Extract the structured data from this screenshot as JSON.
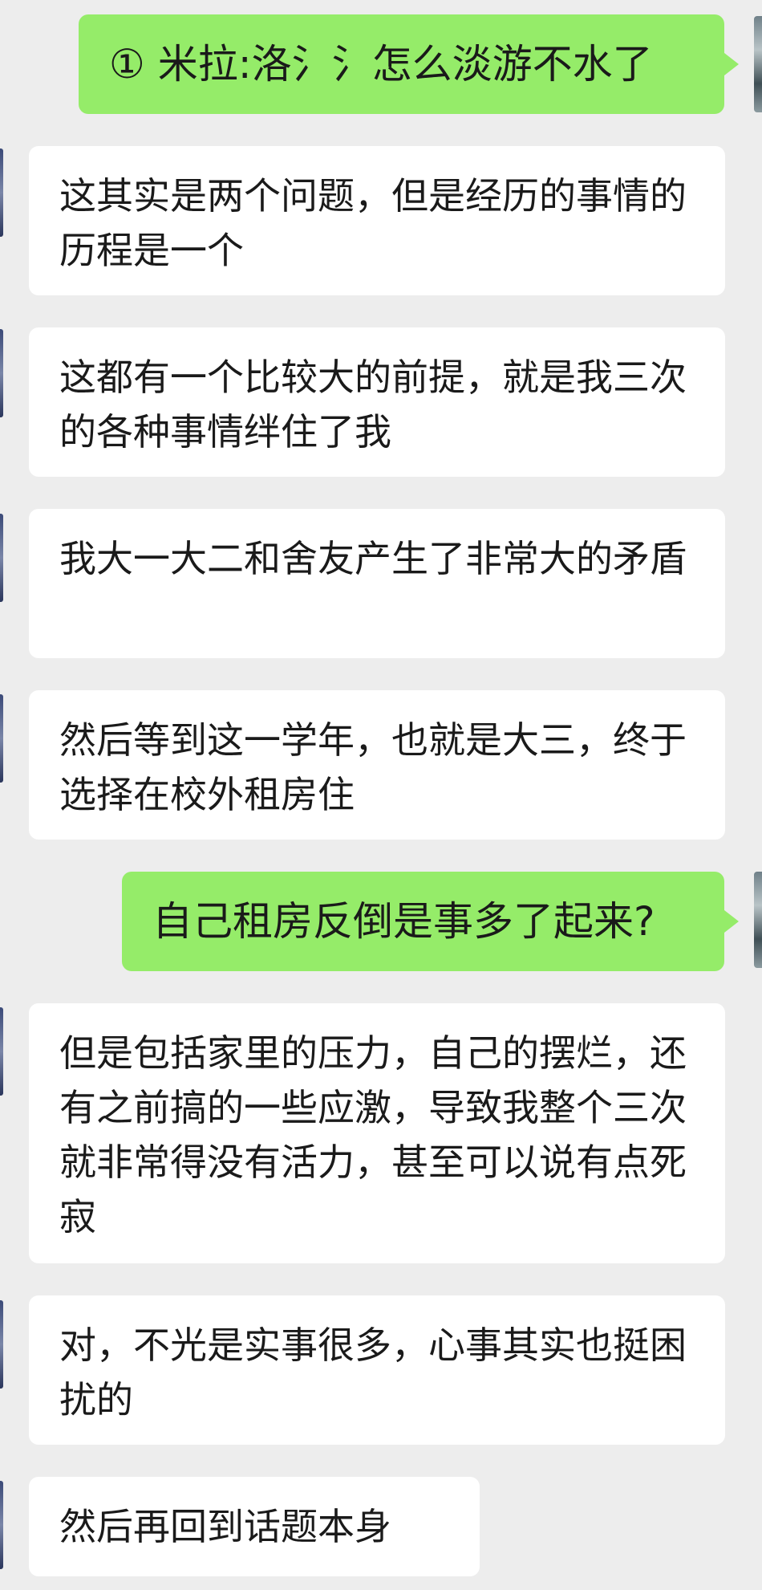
{
  "chat": {
    "messages": [
      {
        "direction": "sent",
        "text": "① 米拉:洛氵氵怎么淡游不水了"
      },
      {
        "direction": "received",
        "text": "这其实是两个问题，但是经历的事情的历程是一个"
      },
      {
        "direction": "received",
        "text": "这都有一个比较大的前提，就是我三次的各种事情绊住了我"
      },
      {
        "direction": "received",
        "text": "我大一大二和舍友产生了非常大的矛盾"
      },
      {
        "direction": "received",
        "text": "然后等到这一学年，也就是大三，终于选择在校外租房住"
      },
      {
        "direction": "sent",
        "text": "自己租房反倒是事多了起来?"
      },
      {
        "direction": "received",
        "text": "但是包括家里的压力，自己的摆烂，还有之前搞的一些应激，导致我整个三次就非常得没有活力，甚至可以说有点死寂"
      },
      {
        "direction": "received",
        "text": "对，不光是实事很多，心事其实也挺困扰的"
      },
      {
        "direction": "received",
        "text": "然后再回到话题本身"
      }
    ]
  },
  "colors": {
    "background": "#ededed",
    "sent_bubble": "#95ec69",
    "received_bubble": "#ffffff",
    "text": "#1a1a1a"
  }
}
